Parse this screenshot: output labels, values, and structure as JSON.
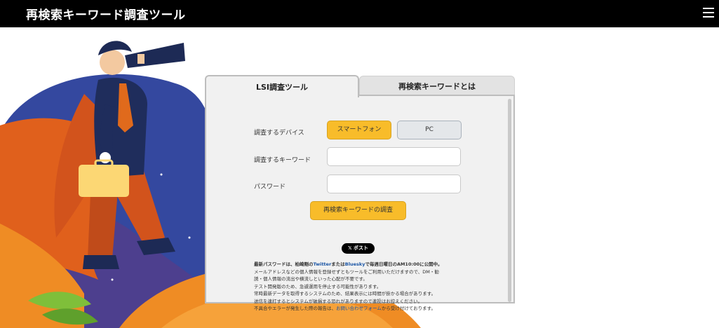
{
  "header": {
    "title": "再検索キーワード調査ツール",
    "menu_icon": "hamburger-icon"
  },
  "tabs": [
    {
      "label": "LSI調査ツール",
      "active": true
    },
    {
      "label": "再検索キーワードとは",
      "active": false
    }
  ],
  "form": {
    "device_label": "調査するデバイス",
    "device_options": [
      "スマートフォン",
      "PC"
    ],
    "device_selected": "スマートフォン",
    "keyword_label": "調査するキーワード",
    "keyword_value": "",
    "password_label": "パスワード",
    "password_value": "",
    "submit_label": "再検索キーワードの調査"
  },
  "share": {
    "post_label": "ポスト",
    "icon": "x-logo-icon"
  },
  "notes": {
    "line1_prefix": "最新パスワードは、柏崎剛の",
    "line1_twitter": "Twitter",
    "line1_mid": "または",
    "line1_bluesky": "Bluesky",
    "line1_suffix": "で毎週日曜日のAM10:00に公開中。",
    "line2": "メールアドレスなどの個人情報を登録せずともツールをご利用いただけますので、DM・勧",
    "line3": "誘・個人情報の流出や横流しといった心配が不要です。",
    "line4": "テスト開発版のため、急遽運用を停止する可能性があります。",
    "line5": "常時最新データを取得するシステムのため、結果表示には時間が掛かる場合があります。",
    "line6": "送信を連打するとシステムが破損する恐れがありますので連投はお控えください。",
    "line7_prefix": "不具合やエラーが発生した際の報告は、",
    "line7_link": "お問い合わせフォーム",
    "line7_suffix": "から受け付けております。"
  },
  "colors": {
    "accent_yellow": "#f8bc2a",
    "link_blue": "#1a55a5",
    "header_bg": "#000000"
  }
}
